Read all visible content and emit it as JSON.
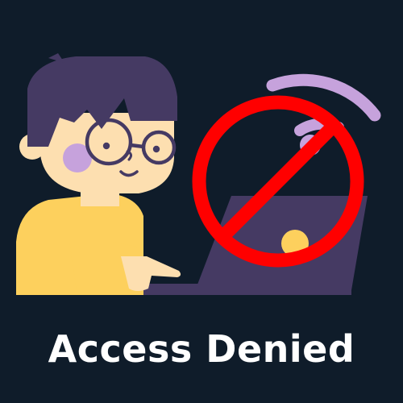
{
  "caption": {
    "text": "Access Denied"
  },
  "colors": {
    "background": "#0f1c2a",
    "hair": "#453a63",
    "skin": "#fddfb0",
    "cheek": "#c6a2dc",
    "shirt": "#fdd05d",
    "laptop": "#453a63",
    "wifi": "#c6a2dc",
    "prohibition": "#ff0000",
    "caption_text": "#ffffff"
  },
  "icons": [
    "person-figure",
    "laptop",
    "wifi-icon",
    "prohibition-icon"
  ]
}
